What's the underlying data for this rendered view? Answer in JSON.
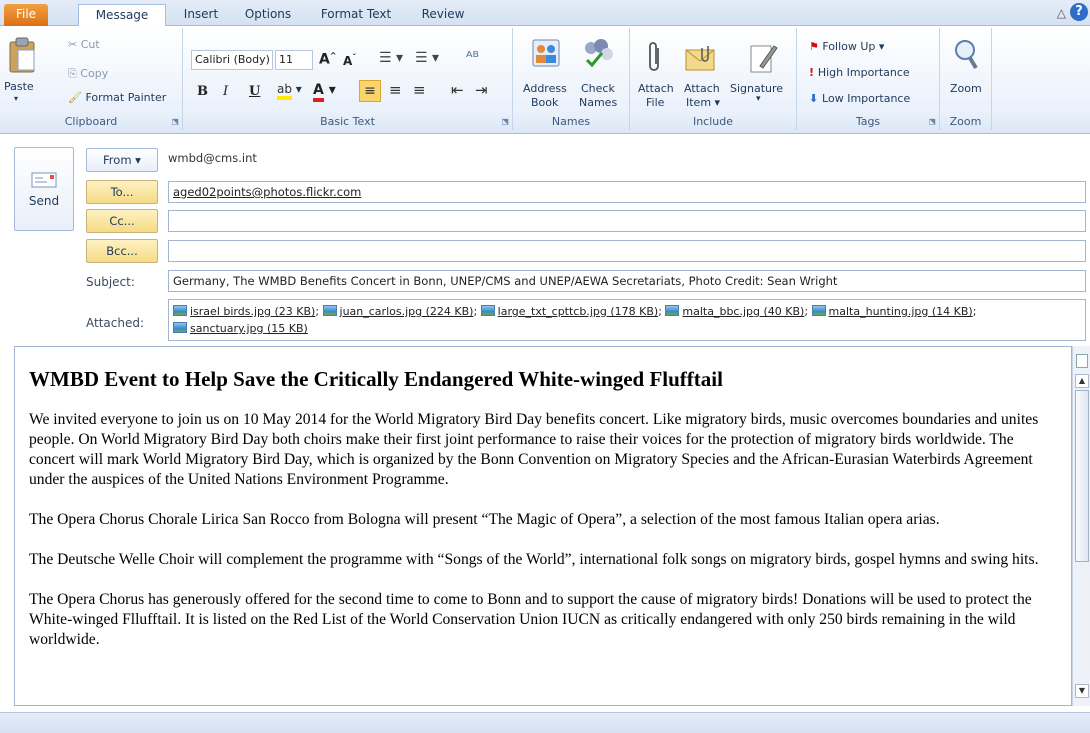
{
  "tabs": {
    "file": "File",
    "message": "Message",
    "insert": "Insert",
    "options": "Options",
    "format_text": "Format Text",
    "review": "Review"
  },
  "ribbon": {
    "clipboard": {
      "label": "Clipboard",
      "paste": "Paste",
      "cut": "Cut",
      "copy": "Copy",
      "format_painter": "Format Painter"
    },
    "basic_text": {
      "label": "Basic Text",
      "font_name": "Calibri (Body)",
      "font_size": "11",
      "bold": "B",
      "italic": "I",
      "underline": "U"
    },
    "names": {
      "label": "Names",
      "address_book_1": "Address",
      "address_book_2": "Book",
      "check_names_1": "Check",
      "check_names_2": "Names"
    },
    "include": {
      "label": "Include",
      "attach_file_1": "Attach",
      "attach_file_2": "File",
      "attach_item_1": "Attach",
      "attach_item_2": "Item ▾",
      "signature_1": "Signature",
      "signature_2": "▾"
    },
    "tags": {
      "label": "Tags",
      "follow_up": "Follow Up ▾",
      "high_importance": "High Importance",
      "low_importance": "Low Importance"
    },
    "zoom": {
      "label": "Zoom",
      "zoom": "Zoom"
    }
  },
  "header": {
    "send": "Send",
    "from_button": "From ▾",
    "from_value": "wmbd@cms.int",
    "to_button": "To...",
    "to_value": "aged02points@photos.flickr.com",
    "cc_button": "Cc...",
    "cc_value": "",
    "bcc_button": "Bcc...",
    "bcc_value": "",
    "subject_label": "Subject:",
    "subject_value": "Germany, The WMBD Benefits Concert in Bonn, UNEP/CMS and UNEP/AEWA Secretariats, Photo Credit: Sean Wright",
    "attached_label": "Attached:",
    "attachments": [
      "israel birds.jpg (23 KB)",
      "juan_carlos.jpg (224 KB)",
      "large_txt_cpttcb.jpg (178 KB)",
      "malta_bbc.jpg (40 KB)",
      "malta_hunting.jpg (14 KB)",
      "sanctuary.jpg (15 KB)"
    ]
  },
  "body": {
    "title": "WMBD Event to Help Save the Critically Endangered White-winged Flufftail",
    "p1": "We invited everyone to join us on 10 May 2014 for the World Migratory Bird Day benefits concert. Like migratory birds, music overcomes boundaries and unites people. On World Migratory Bird Day both choirs make their first joint performance to raise their voices for the protection of migratory birds worldwide. The concert will mark World Migratory Bird Day, which is organized by the Bonn Convention on Migratory Species and the African-Eurasian Waterbirds Agreement under the auspices of the United Nations Environment Programme.",
    "p2": "The Opera Chorus Chorale Lirica San Rocco from Bologna will present “The Magic of Opera”, a selection of the most famous Italian opera arias.",
    "p3": "The Deutsche Welle Choir will complement the programme with “Songs of the World”, international folk songs on migratory birds, gospel hymns and swing hits.",
    "p4": "The Opera Chorus has generously offered for the second time to come to Bonn and to support the cause of migratory birds! Donations will be used to protect the White-winged Fllufftail. It is listed on the Red List of the World Conservation Union IUCN as critically endangered with only 250 birds remaining in the wild worldwide."
  },
  "colors": {
    "file_tab": "#de6f15",
    "ribbon_bg": "#eaf1fb",
    "header_button": "#f6da84",
    "accent": "#2e6dc7"
  }
}
